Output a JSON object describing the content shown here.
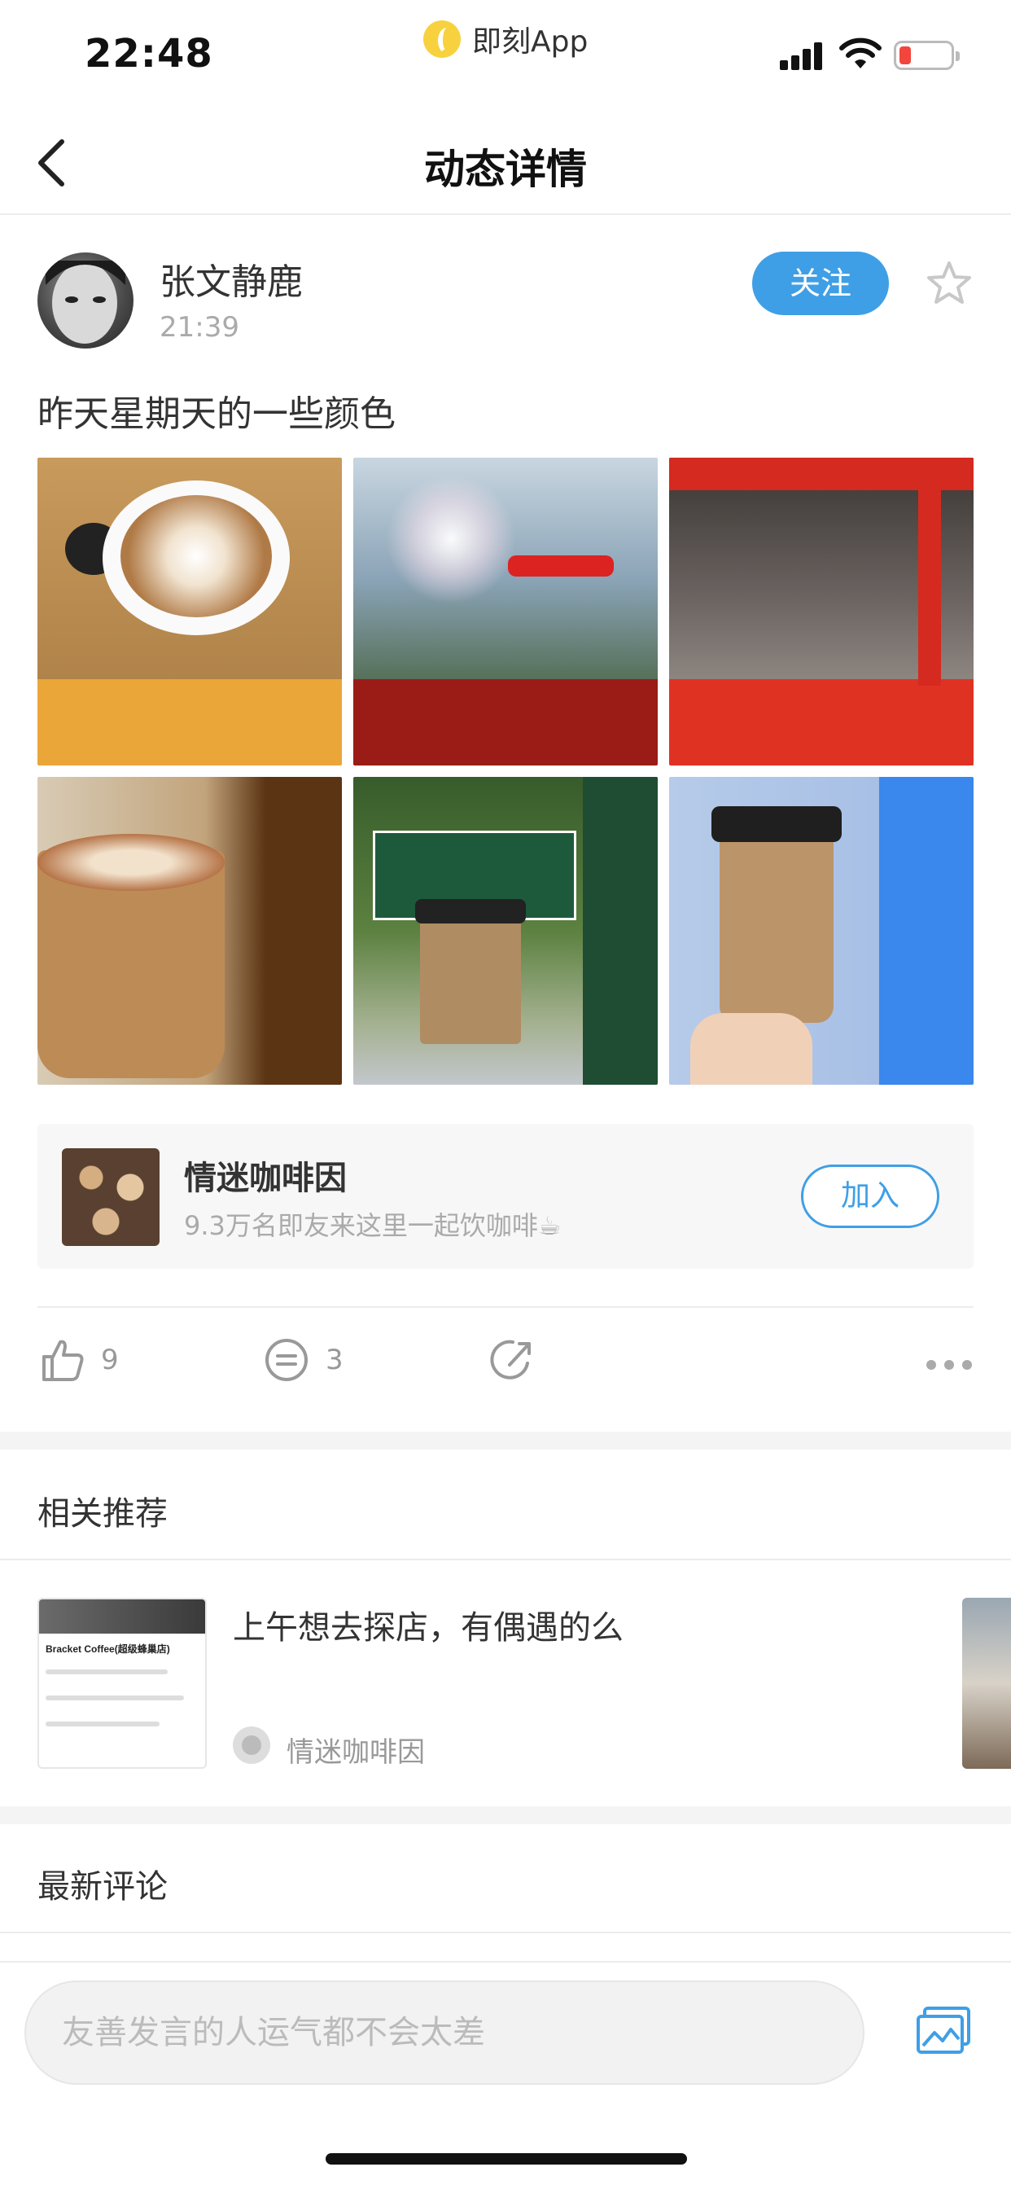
{
  "status_bar": {
    "time": "22:48",
    "app_name": "即刻App"
  },
  "nav": {
    "title": "动态详情",
    "back_icon": "chevron-left-icon"
  },
  "post": {
    "author": "张文静鹿",
    "time": "21:39",
    "follow_label": "关注",
    "text": "昨天星期天的一些颜色",
    "photos": [
      {
        "palette_color": "#eba63a"
      },
      {
        "palette_color": "#9b1c16"
      },
      {
        "palette_color": "#e03223"
      },
      {
        "palette_color": "#5b3413"
      },
      {
        "palette_color": "#1e4d33"
      },
      {
        "palette_color": "#3a87ee"
      }
    ]
  },
  "group": {
    "name": "情迷咖啡因",
    "desc": "9.3万名即友来这里一起饮咖啡☕",
    "join_label": "加入"
  },
  "actions": {
    "likes": "9",
    "comments": "3"
  },
  "recommend": {
    "section_title": "相关推荐",
    "items": [
      {
        "thumb_text": "Bracket Coffee(超级蜂巢店)",
        "title": "上午想去探店，有偶遇的么",
        "group": "情迷咖啡因"
      }
    ]
  },
  "comments": {
    "section_title": "最新评论",
    "input_placeholder": "友善发言的人运气都不会太差"
  },
  "colors": {
    "accent": "#3f9fe6",
    "text_primary": "#333333",
    "text_secondary": "#aaaaaa"
  }
}
